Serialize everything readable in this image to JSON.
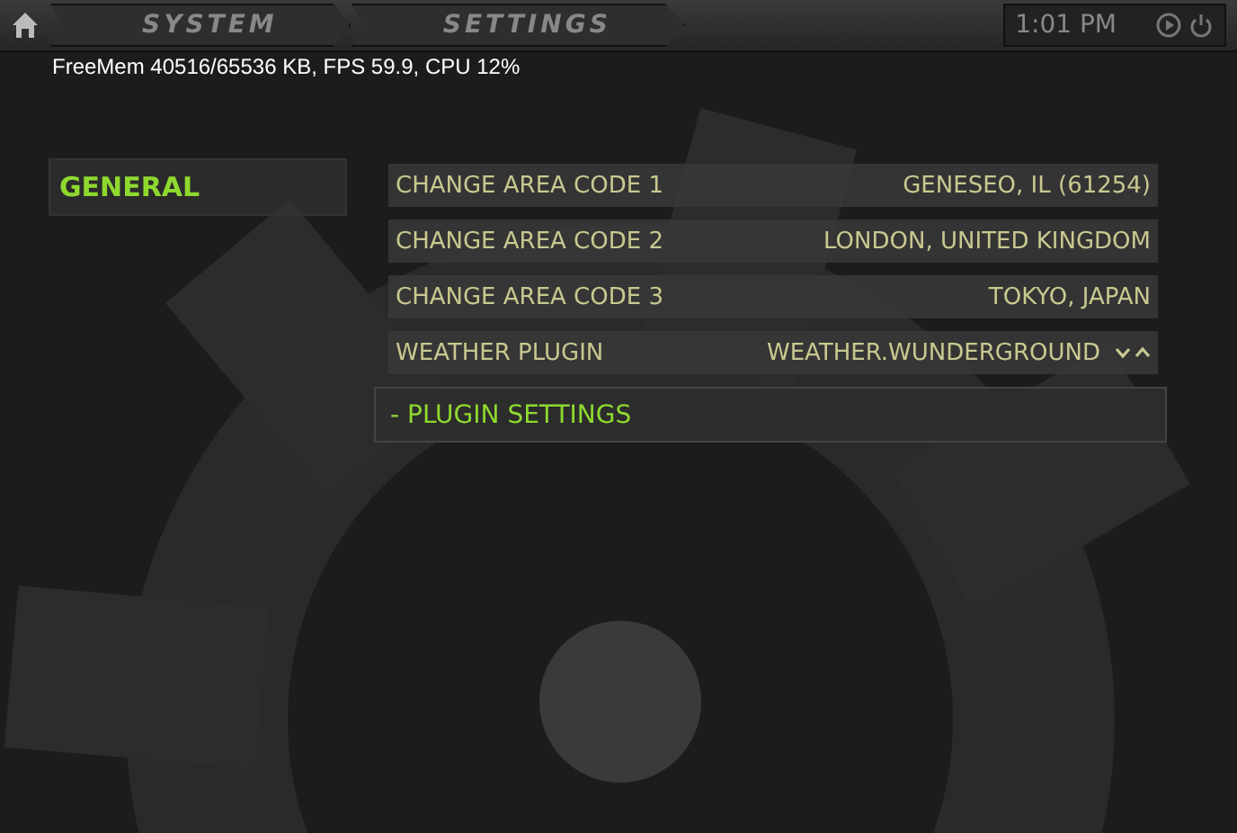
{
  "breadcrumbs": [
    "SYSTEM",
    "SETTINGS"
  ],
  "clock": "1:01 PM",
  "debug_info": "FreeMem 40516/65536 KB, FPS 59.9, CPU 12%",
  "categories": [
    {
      "label": "GENERAL",
      "selected": true
    }
  ],
  "settings": [
    {
      "kind": "value",
      "label": "CHANGE AREA CODE 1",
      "value": "GENESEO, IL (61254)",
      "selected": false
    },
    {
      "kind": "value",
      "label": "CHANGE AREA CODE 2",
      "value": "LONDON, UNITED KINGDOM",
      "selected": false
    },
    {
      "kind": "value",
      "label": "CHANGE AREA CODE 3",
      "value": "TOKYO, JAPAN",
      "selected": false
    },
    {
      "kind": "spinner",
      "label": "WEATHER PLUGIN",
      "value": "WEATHER.WUNDERGROUND",
      "selected": false
    },
    {
      "kind": "action",
      "label": "- PLUGIN SETTINGS",
      "selected": true
    }
  ]
}
